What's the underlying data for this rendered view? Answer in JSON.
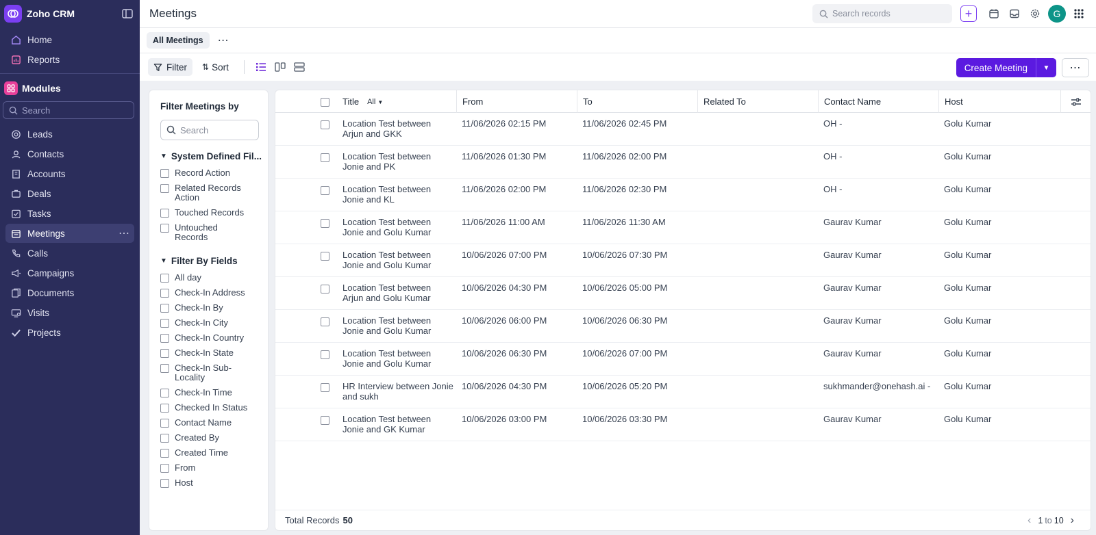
{
  "app": {
    "title": "Zoho CRM"
  },
  "sidebar": {
    "top_items": [
      {
        "label": "Home",
        "icon": "home-icon"
      },
      {
        "label": "Reports",
        "icon": "reports-icon"
      }
    ],
    "modules_label": "Modules",
    "search_placeholder": "Search",
    "items": [
      {
        "label": "Leads",
        "icon": "leads-icon"
      },
      {
        "label": "Contacts",
        "icon": "contacts-icon"
      },
      {
        "label": "Accounts",
        "icon": "accounts-icon"
      },
      {
        "label": "Deals",
        "icon": "deals-icon"
      },
      {
        "label": "Tasks",
        "icon": "tasks-icon"
      },
      {
        "label": "Meetings",
        "icon": "meetings-icon",
        "active": true
      },
      {
        "label": "Calls",
        "icon": "calls-icon"
      },
      {
        "label": "Campaigns",
        "icon": "campaigns-icon"
      },
      {
        "label": "Documents",
        "icon": "documents-icon"
      },
      {
        "label": "Visits",
        "icon": "visits-icon"
      },
      {
        "label": "Projects",
        "icon": "projects-icon"
      }
    ],
    "more_glyph": "⋯"
  },
  "header": {
    "page_title": "Meetings",
    "search_placeholder": "Search records",
    "plus": "+",
    "avatar_letter": "G"
  },
  "tabs": {
    "active": "All Meetings",
    "more_glyph": "⋯"
  },
  "toolbar": {
    "filter_label": "Filter",
    "sort_label": "Sort",
    "sort_glyph": "⇅",
    "create_label": "Create Meeting",
    "caret": "▼",
    "more_glyph": "⋯"
  },
  "filter_panel": {
    "title": "Filter Meetings by",
    "search_placeholder": "Search",
    "collapse_glyph": "▼",
    "sections": [
      {
        "title": "System Defined Fil...",
        "items": [
          "Record Action",
          "Related Records Action",
          "Touched Records",
          "Untouched Records"
        ]
      },
      {
        "title": "Filter By Fields",
        "items": [
          "All day",
          "Check-In Address",
          "Check-In By",
          "Check-In City",
          "Check-In Country",
          "Check-In State",
          "Check-In Sub-Locality",
          "Check-In Time",
          "Checked In Status",
          "Contact Name",
          "Created By",
          "Created Time",
          "From",
          "Host"
        ]
      }
    ]
  },
  "table": {
    "columns": {
      "title": "Title",
      "title_filter": "All",
      "caret": "▼",
      "from": "From",
      "to": "To",
      "related_to": "Related To",
      "contact_name": "Contact Name",
      "host": "Host"
    },
    "rows": [
      {
        "title": "Location Test between Arjun and GKK",
        "from": "11/06/2026 02:15 PM",
        "to": "11/06/2026 02:45 PM",
        "related_to": "",
        "contact": "OH -",
        "host": "Golu Kumar"
      },
      {
        "title": "Location Test between Jonie and PK",
        "from": "11/06/2026 01:30 PM",
        "to": "11/06/2026 02:00 PM",
        "related_to": "",
        "contact": "OH -",
        "host": "Golu Kumar"
      },
      {
        "title": "Location Test between Jonie and KL",
        "from": "11/06/2026 02:00 PM",
        "to": "11/06/2026 02:30 PM",
        "related_to": "",
        "contact": "OH -",
        "host": "Golu Kumar"
      },
      {
        "title": "Location Test between Jonie and Golu Kumar",
        "from": "11/06/2026 11:00 AM",
        "to": "11/06/2026 11:30 AM",
        "related_to": "",
        "contact": "Gaurav Kumar",
        "host": "Golu Kumar"
      },
      {
        "title": "Location Test between Jonie and Golu Kumar",
        "from": "10/06/2026 07:00 PM",
        "to": "10/06/2026 07:30 PM",
        "related_to": "",
        "contact": "Gaurav Kumar",
        "host": "Golu Kumar"
      },
      {
        "title": "Location Test between Arjun and Golu Kumar",
        "from": "10/06/2026 04:30 PM",
        "to": "10/06/2026 05:00 PM",
        "related_to": "",
        "contact": "Gaurav Kumar",
        "host": "Golu Kumar"
      },
      {
        "title": "Location Test between Jonie and Golu Kumar",
        "from": "10/06/2026 06:00 PM",
        "to": "10/06/2026 06:30 PM",
        "related_to": "",
        "contact": "Gaurav Kumar",
        "host": "Golu Kumar"
      },
      {
        "title": "Location Test between Jonie and Golu Kumar",
        "from": "10/06/2026 06:30 PM",
        "to": "10/06/2026 07:00 PM",
        "related_to": "",
        "contact": "Gaurav Kumar",
        "host": "Golu Kumar"
      },
      {
        "title": "HR Interview between Jonie and sukh",
        "from": "10/06/2026 04:30 PM",
        "to": "10/06/2026 05:20 PM",
        "related_to": "",
        "contact": "sukhmander@onehash.ai -",
        "host": "Golu Kumar"
      },
      {
        "title": "Location Test between Jonie and GK Kumar",
        "from": "10/06/2026 03:00 PM",
        "to": "10/06/2026 03:30 PM",
        "related_to": "",
        "contact": "Gaurav Kumar",
        "host": "Golu Kumar"
      }
    ],
    "footer": {
      "total_label": "Total Records",
      "total_count": "50",
      "range_start": "1",
      "range_to": "to",
      "range_end": "10",
      "prev_glyph": "‹",
      "next_glyph": "›"
    }
  },
  "colors": {
    "sidebar_bg": "#2b2d5b",
    "accent": "#5b1ae0",
    "logo": "#7b3ff2",
    "avatar": "#0d9488",
    "modules_icon": "#e8409a"
  }
}
